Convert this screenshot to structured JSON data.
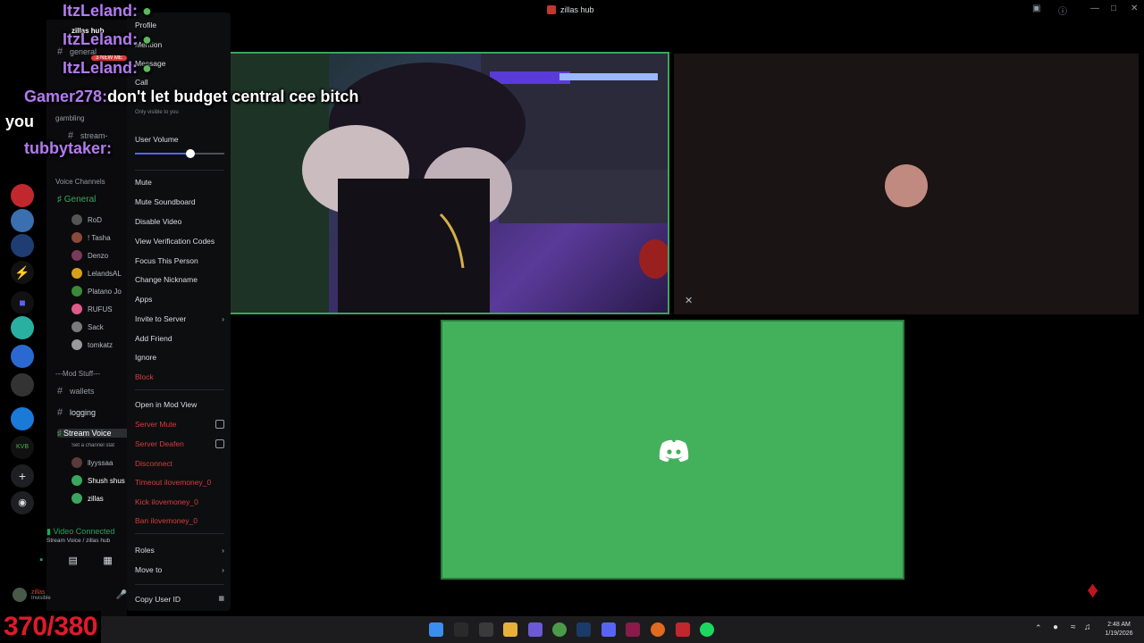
{
  "window": {
    "title": "zillas hub"
  },
  "server_header": {
    "name": "zillas hub"
  },
  "channels": {
    "text": [
      "general",
      "stream-"
    ],
    "new_badge": "3 NEW ME",
    "category_gambling": "gambling",
    "voice_header": "Voice Channels",
    "general_voice": "General",
    "general_users": [
      "RoD",
      "! Tasha",
      "Denzo",
      "LelandsAL",
      "Platano Jo",
      "RUFUS",
      "Sack",
      "tomkatz"
    ],
    "mod_header": "---Mod Stuff---",
    "wallets": "wallets",
    "logging": "logging",
    "stream_voice": "Stream Voice",
    "stream_voice_status": "Set a channel stat",
    "stream_users": [
      "llyyssaa",
      "Shush shus",
      "zillas"
    ]
  },
  "voice_panel": {
    "status": "Video Connected",
    "location": "Stream Voice / zillas hub"
  },
  "user_panel": {
    "name": "zillas",
    "status": "Invisible"
  },
  "context_menu": {
    "profile": "Profile",
    "mention": "Mention",
    "message": "Message",
    "call": "Call",
    "note_hint": "Only visible to you",
    "user_volume": "User Volume",
    "volume_percent": 62,
    "mute": "Mute",
    "mute_soundboard": "Mute Soundboard",
    "disable_video": "Disable Video",
    "view_verification": "View Verification Codes",
    "focus_person": "Focus This Person",
    "change_nickname": "Change Nickname",
    "apps": "Apps",
    "invite_server": "Invite to Server",
    "add_friend": "Add Friend",
    "ignore": "Ignore",
    "block": "Block",
    "open_mod_view": "Open in Mod View",
    "server_mute": "Server Mute",
    "server_deafen": "Server Deafen",
    "disconnect": "Disconnect",
    "timeout": "Timeout ilovemoney_0",
    "kick": "Kick ilovemoney_0",
    "ban": "Ban ilovemoney_0",
    "roles": "Roles",
    "move_to": "Move to",
    "copy_user_id": "Copy User ID"
  },
  "chat_overlay": {
    "messages": [
      {
        "user": "ItzLeland:",
        "text": ""
      },
      {
        "user": "ItzLeland:",
        "text": ""
      },
      {
        "user": "ItzLeland:",
        "text": ""
      },
      {
        "user": "Gamer278:",
        "text": "don't let budget central cee bitch"
      },
      {
        "user": "you",
        "text": ""
      },
      {
        "user": "tubbytaker:",
        "text": ""
      }
    ]
  },
  "taskbar": {
    "time": "2:48 AM",
    "date": "1/19/2026"
  },
  "counter": {
    "text": "370/380"
  },
  "colors": {
    "accent_green": "#43b05c",
    "danger": "#d83c3e",
    "counter_red": "#e01a2a",
    "chat_purple": "#b37bf0"
  }
}
